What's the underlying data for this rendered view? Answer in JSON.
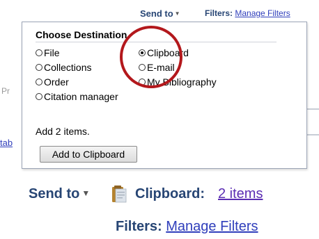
{
  "top_bar": {
    "send_to_label": "Send to",
    "filters_label": "Filters:",
    "manage_filters_link": "Manage Filters"
  },
  "background": {
    "left_fragment": "Pr",
    "left_link_fragment": "tab"
  },
  "send_to_panel": {
    "title": "Choose Destination",
    "options": [
      {
        "label": "File",
        "selected": false
      },
      {
        "label": "Clipboard",
        "selected": true
      },
      {
        "label": "Collections",
        "selected": false
      },
      {
        "label": "E-mail",
        "selected": false
      },
      {
        "label": "Order",
        "selected": false
      },
      {
        "label": "My Bibliography",
        "selected": false
      },
      {
        "label": "Citation manager",
        "selected": false
      }
    ],
    "add_count_text": "Add 2 items.",
    "add_button_label": "Add to Clipboard"
  },
  "after_toolbar": {
    "send_to_label": "Send to",
    "clipboard_label": "Clipboard:",
    "clipboard_items_link": "2 items",
    "filters_label": "Filters:",
    "manage_filters_link": "Manage Filters",
    "clipboard_icon": "clipboard-icon"
  },
  "annotation": {
    "circle_color": "#b3181c"
  },
  "colors": {
    "heading_blue": "#274574",
    "link_blue": "#2f3ebb",
    "visited_purple": "#5b2db3"
  }
}
